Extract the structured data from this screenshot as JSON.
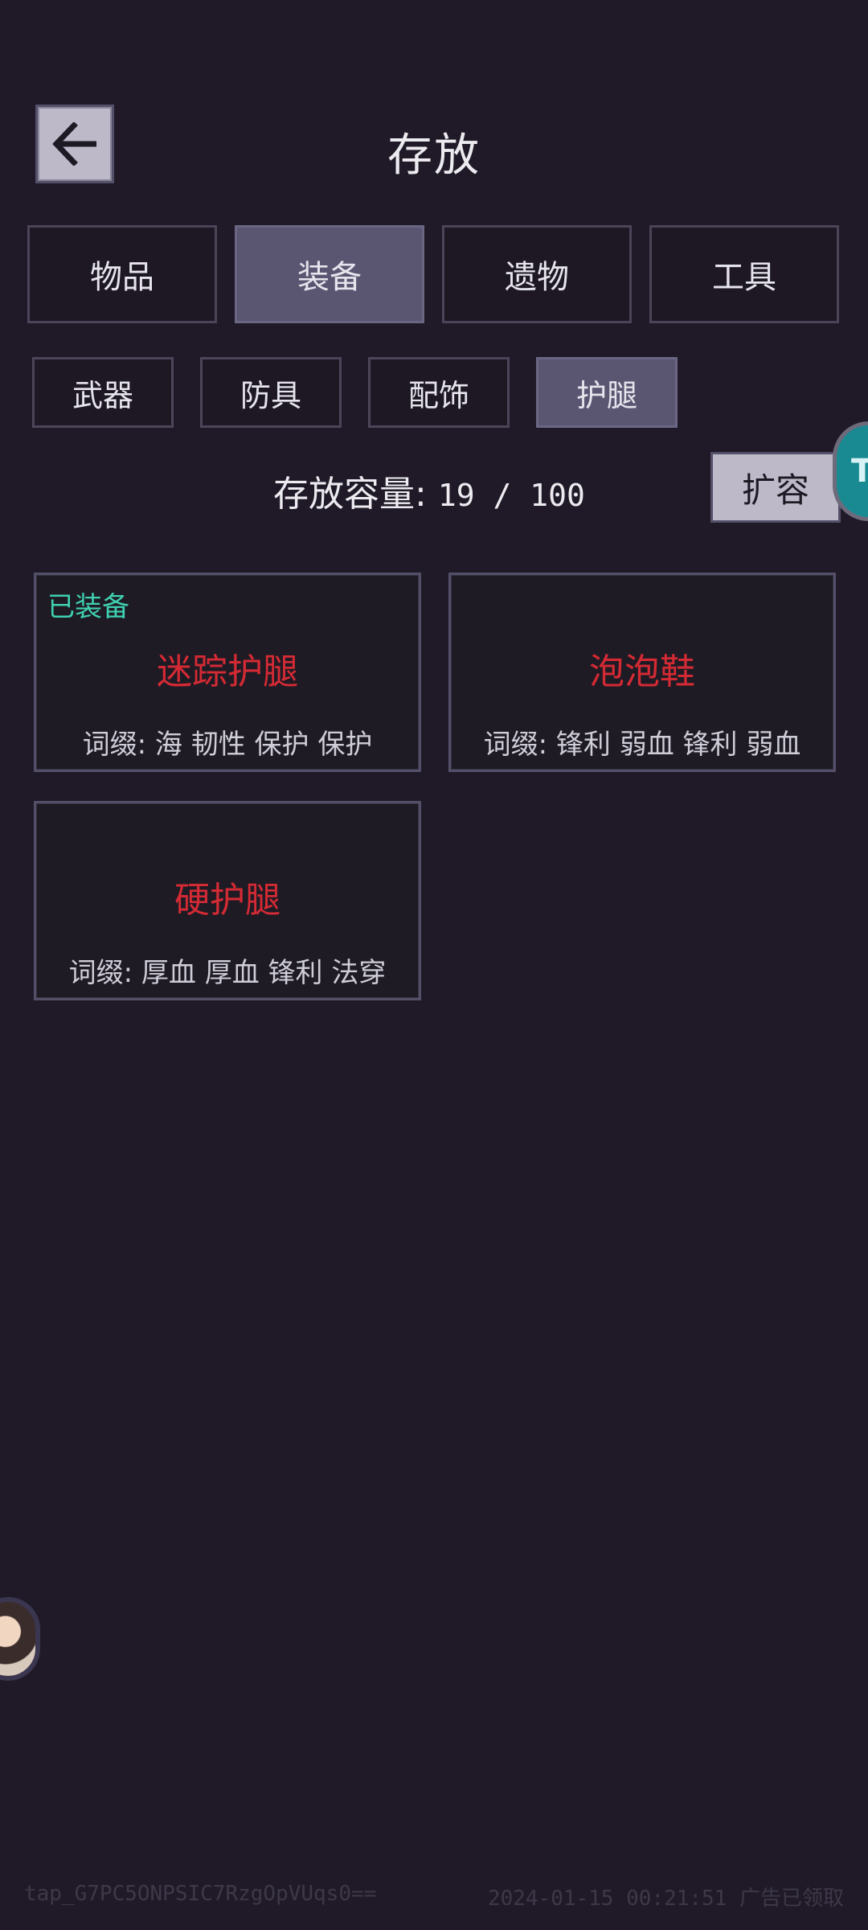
{
  "header": {
    "back_icon": "arrow-left-icon",
    "title": "存放"
  },
  "category_tabs": [
    {
      "label": "物品",
      "active": false
    },
    {
      "label": "装备",
      "active": true
    },
    {
      "label": "遗物",
      "active": false
    },
    {
      "label": "工具",
      "active": false
    }
  ],
  "sub_tabs": [
    {
      "label": "武器",
      "active": false
    },
    {
      "label": "防具",
      "active": false
    },
    {
      "label": "配饰",
      "active": false
    },
    {
      "label": "护腿",
      "active": true
    }
  ],
  "storage": {
    "label": "存放容量:",
    "value": "19 / 100",
    "expand_label": "扩容"
  },
  "edge_badge": {
    "text": "T"
  },
  "items": [
    {
      "equipped_label": "已装备",
      "name": "迷踪护腿",
      "affixes": "词缀: 海 韧性 保护 保护"
    },
    {
      "equipped_label": "",
      "name": "泡泡鞋",
      "affixes": "词缀: 锋利 弱血 锋利 弱血"
    },
    {
      "equipped_label": "",
      "name": "硬护腿",
      "affixes": "词缀: 厚血 厚血 锋利 法穿"
    }
  ],
  "footer": {
    "left": "tap_G7PC5ONPSIC7RzgOpVUqs0==",
    "right": "2024-01-15 00:21:51 广告已领取"
  },
  "colors": {
    "background": "#201a28",
    "active_tab": "#5a5672",
    "item_name": "#d42a34",
    "equipped": "#3fd0b0"
  }
}
